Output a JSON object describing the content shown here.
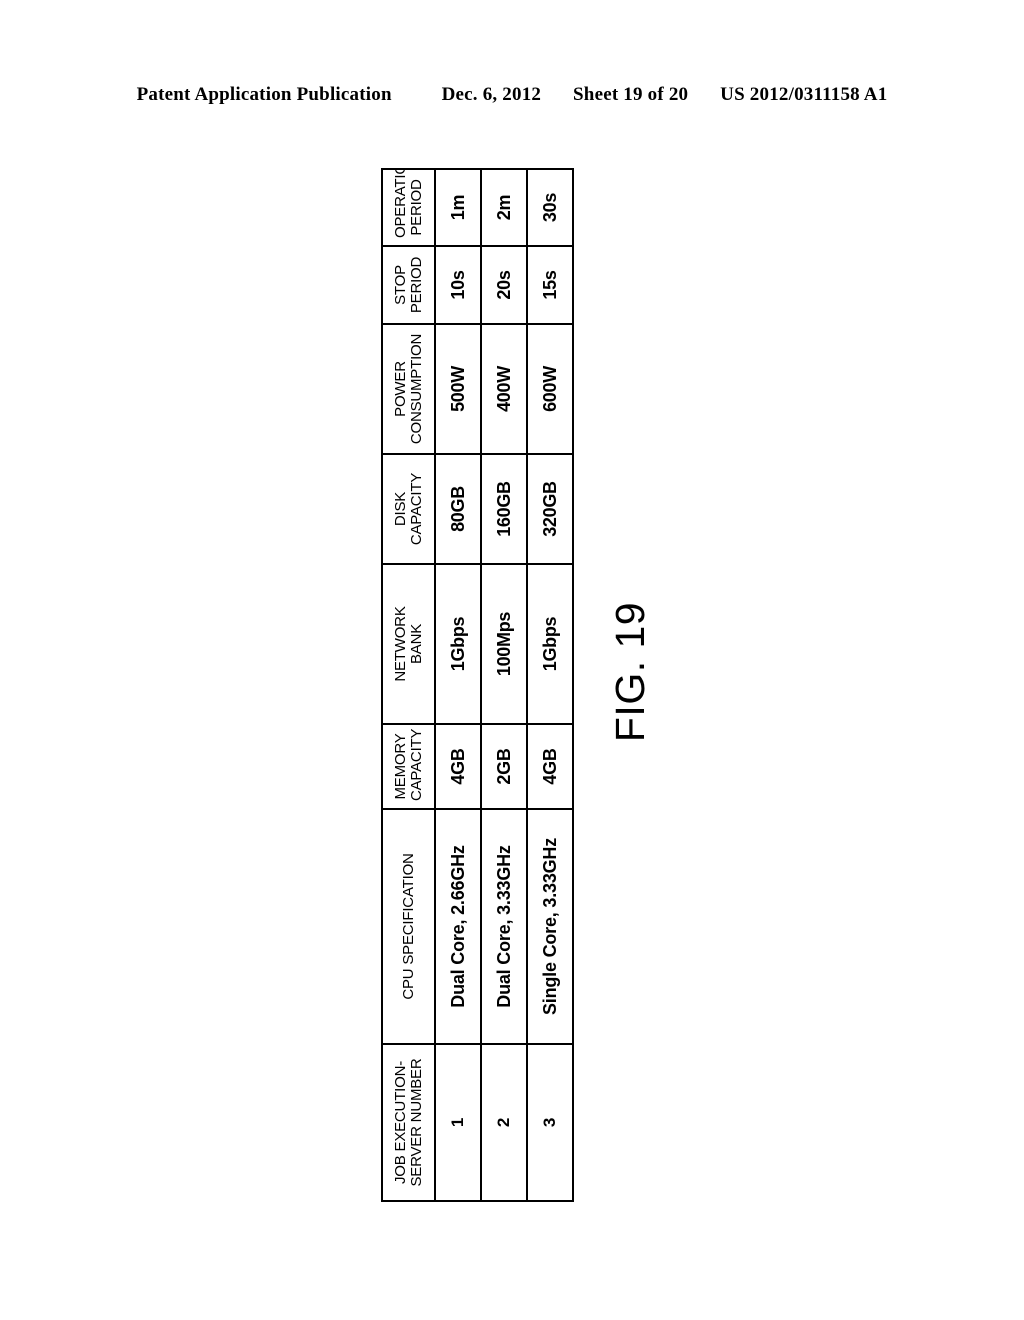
{
  "page": {
    "header": {
      "publication": "Patent Application Publication",
      "date": "Dec. 6, 2012",
      "sheet": "Sheet 19 of 20",
      "document_number": "US 2012/0311158 A1"
    },
    "figure_label": "FIG. 19"
  },
  "table": {
    "orientation": "rotated-90-ccw",
    "columns": [
      {
        "key": "server_number",
        "header": "JOB EXECUTION-\nSERVER NUMBER"
      },
      {
        "key": "cpu_specification",
        "header": "CPU SPECIFICATION"
      },
      {
        "key": "memory_capacity",
        "header": "MEMORY\nCAPACITY"
      },
      {
        "key": "network_bank",
        "header": "NETWORK\nBANK"
      },
      {
        "key": "disk_capacity",
        "header": "DISK\nCAPACITY"
      },
      {
        "key": "power_consumption",
        "header": "POWER\nCONSUMPTION"
      },
      {
        "key": "stop_period",
        "header": "STOP\nPERIOD"
      },
      {
        "key": "operation_period",
        "header": "OPERATION\nPERIOD"
      }
    ],
    "rows": [
      {
        "server_number": "1",
        "cpu_specification": "Dual Core, 2.66GHz",
        "memory_capacity": "4GB",
        "network_bank": "1Gbps",
        "disk_capacity": "80GB",
        "power_consumption": "500W",
        "stop_period": "10s",
        "operation_period": "1m"
      },
      {
        "server_number": "2",
        "cpu_specification": "Dual Core, 3.33GHz",
        "memory_capacity": "2GB",
        "network_bank": "100Mps",
        "disk_capacity": "160GB",
        "power_consumption": "400W",
        "stop_period": "20s",
        "operation_period": "2m"
      },
      {
        "server_number": "3",
        "cpu_specification": "Single Core, 3.33GHz",
        "memory_capacity": "4GB",
        "network_bank": "1Gbps",
        "disk_capacity": "320GB",
        "power_consumption": "600W",
        "stop_period": "15s",
        "operation_period": "30s"
      }
    ]
  }
}
